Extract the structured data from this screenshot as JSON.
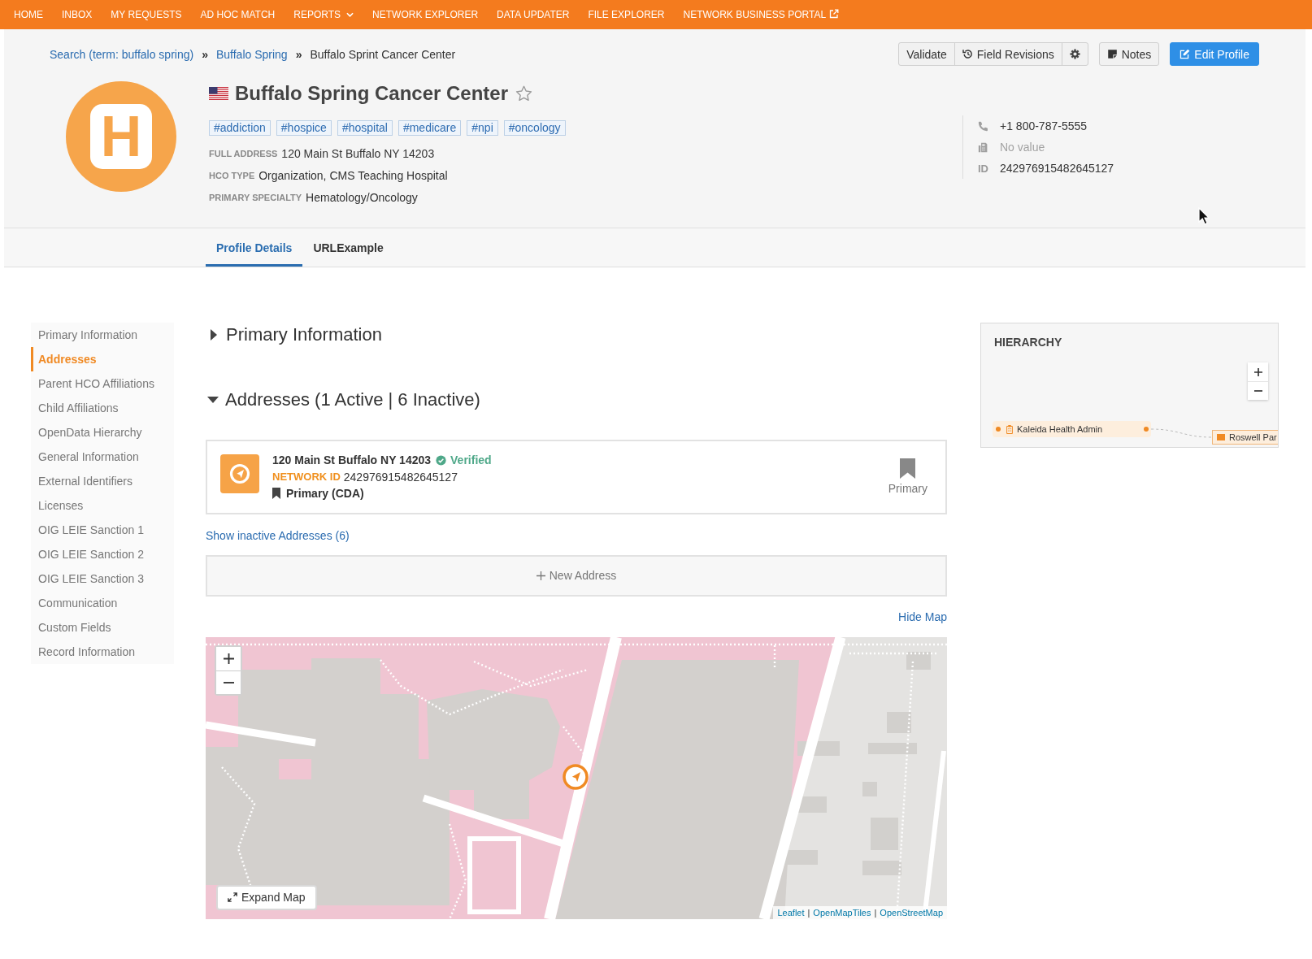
{
  "nav": {
    "items": [
      {
        "label": "HOME",
        "kind": "link"
      },
      {
        "label": "INBOX",
        "kind": "link"
      },
      {
        "label": "MY REQUESTS",
        "kind": "link"
      },
      {
        "label": "AD HOC MATCH",
        "kind": "link"
      },
      {
        "label": "REPORTS",
        "kind": "dropdown"
      },
      {
        "label": "NETWORK EXPLORER",
        "kind": "link"
      },
      {
        "label": "DATA UPDATER",
        "kind": "link"
      },
      {
        "label": "FILE EXPLORER",
        "kind": "link"
      },
      {
        "label": "NETWORK BUSINESS PORTAL",
        "kind": "external"
      }
    ]
  },
  "breadcrumb": [
    {
      "label": "Search (term: buffalo spring)",
      "kind": "link"
    },
    {
      "separator": "»",
      "label": "Buffalo Spring",
      "kind": "link"
    },
    {
      "separator": "»",
      "label": "Buffalo Sprint Cancer Center",
      "kind": "current"
    }
  ],
  "actions": {
    "groups": [
      [
        {
          "kind": "validate",
          "label": "Validate"
        },
        {
          "kind": "history",
          "label": "Field Revisions"
        },
        {
          "kind": "settings"
        }
      ],
      [
        {
          "kind": "notes",
          "label": "Notes"
        }
      ],
      [
        {
          "kind": "edit",
          "label": "Edit Profile"
        }
      ]
    ]
  },
  "profile": {
    "logo_text": "H",
    "name": "Buffalo Spring Cancer Center",
    "favorite": false,
    "tags": [
      "#addiction",
      "#hospice",
      "#hospital",
      "#medicare",
      "#npi",
      "#oncology"
    ],
    "fields": [
      {
        "label": "FULL ADDRESS",
        "value": "120 Main St Buffalo NY 14203"
      },
      {
        "label": "HCO TYPE",
        "value": "Organization, CMS Teaching Hospital"
      },
      {
        "label": "PRIMARY SPECIALTY",
        "value": "Hematology/Oncology"
      }
    ],
    "contacts": [
      {
        "kind": "phone",
        "value": "+1 800-787-5555",
        "empty": false
      },
      {
        "kind": "fax",
        "value": "No value",
        "empty": true
      },
      {
        "kind": "id",
        "label": "ID",
        "value": "242976915482645127",
        "empty": false
      }
    ]
  },
  "tabs": [
    {
      "label": "Profile Details",
      "selected": true
    },
    {
      "label": "URLExample",
      "selected": false
    }
  ],
  "sidebar": {
    "items": [
      {
        "label": "Primary Information",
        "selected": false
      },
      {
        "label": "Addresses",
        "selected": true
      },
      {
        "label": "Parent HCO Affiliations",
        "selected": false
      },
      {
        "label": "Child Affiliations",
        "selected": false
      },
      {
        "label": "OpenData Hierarchy",
        "selected": false
      },
      {
        "label": "General Information",
        "selected": false
      },
      {
        "label": "External Identifiers",
        "selected": false
      },
      {
        "label": "Licenses",
        "selected": false
      },
      {
        "label": "OIG LEIE Sanction 1",
        "selected": false
      },
      {
        "label": "OIG LEIE Sanction 2",
        "selected": false
      },
      {
        "label": "OIG LEIE Sanction 3",
        "selected": false
      },
      {
        "label": "Communication",
        "selected": false
      },
      {
        "label": "Custom Fields",
        "selected": false
      },
      {
        "label": "Record Information",
        "selected": false
      }
    ]
  },
  "sections": [
    {
      "kind": "primary_information",
      "title": "Primary Information",
      "expanded": false
    },
    {
      "kind": "addresses",
      "title": "Addresses (1 Active | 6 Inactive)",
      "expanded": true
    }
  ],
  "addresses": {
    "items": [
      {
        "address": "120 Main St Buffalo NY 14203",
        "verified": true,
        "status": "Verified",
        "id_label": "NETWORK ID",
        "network_id": "242976915482645127",
        "type": "Primary (CDA)",
        "primary": true,
        "primary_label": "Primary"
      }
    ],
    "show_inactive": "Show inactive Addresses (6)",
    "new_address": "New Address",
    "hide_map": "Hide Map"
  },
  "map": {
    "expand": "Expand Map",
    "attribution": [
      {
        "label": "Leaflet"
      },
      {
        "separator": "|",
        "label": "OpenMapTiles"
      },
      {
        "separator": "|",
        "label": "OpenStreetMap"
      }
    ]
  },
  "hierarchy": {
    "title": "HIERARCHY",
    "nodes": [
      {
        "label": "Kaleida Health Admin",
        "kind": "parent"
      },
      {
        "label": "Roswell Par",
        "kind": "child"
      }
    ]
  }
}
